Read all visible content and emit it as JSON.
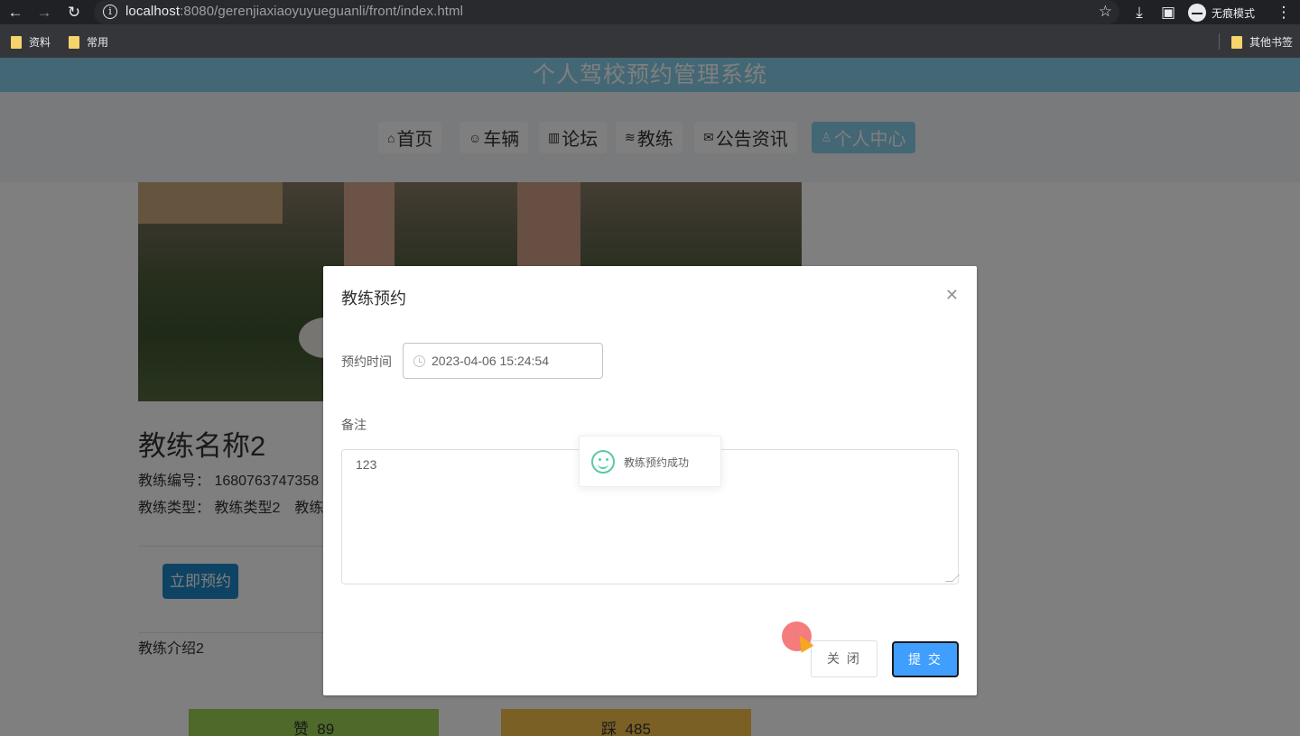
{
  "browser": {
    "url_host": "localhost",
    "url_path": ":8080/gerenjiaxiaoyuyueguanli/front/index.html",
    "incognito_label": "无痕模式",
    "bookmarks": [
      "资料",
      "常用"
    ],
    "other_bookmarks": "其他书签"
  },
  "site": {
    "title": "个人驾校预约管理系统",
    "nav": [
      {
        "icon": "home-icon",
        "label": "首页"
      },
      {
        "icon": "vehicle-icon",
        "label": "车辆"
      },
      {
        "icon": "forum-icon",
        "label": "论坛"
      },
      {
        "icon": "coach-icon",
        "label": "教练"
      },
      {
        "icon": "mail-icon",
        "label": "公告资讯"
      },
      {
        "icon": "user-icon",
        "label": "个人中心"
      }
    ]
  },
  "coach": {
    "name": "教练名称2",
    "number_line": "教练编号： 1680763747358",
    "type_line": "教练类型： 教练类型2　教练",
    "book_now": "立即预约",
    "intro": "教练介绍2",
    "like_label": "赞",
    "like_count": "89",
    "dislike_label": "踩",
    "dislike_count": "485"
  },
  "dialog": {
    "title": "教练预约",
    "time_label": "预约时间",
    "time_value": "2023-04-06 15:24:54",
    "note_label": "备注",
    "note_value": "123",
    "toast": "教练预约成功",
    "cancel": "关 闭",
    "submit": "提 交"
  },
  "colors": {
    "header": "#87ceeb",
    "active_nav": "#87ceeb",
    "primary": "#409eff",
    "success": "#5cc9a7"
  }
}
